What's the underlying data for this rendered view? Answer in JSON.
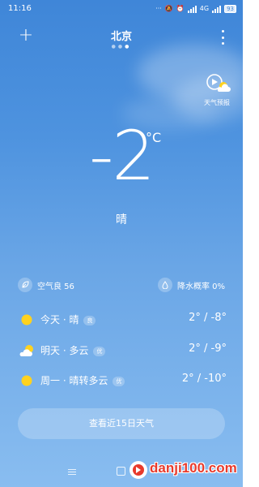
{
  "status_bar": {
    "time": "11:16",
    "network": "4G",
    "battery": "93"
  },
  "header": {
    "city": "北京",
    "page_dots": 3,
    "active_dot": 2
  },
  "forecast_video": {
    "label": "天气预报"
  },
  "current": {
    "temperature": "-2",
    "unit": "°C",
    "condition": "晴"
  },
  "info": {
    "air_quality": "空气良 56",
    "precipitation": "降水概率 0%"
  },
  "days": [
    {
      "label": "今天 · 晴",
      "badge": "良",
      "temps": "2° / -8°",
      "icon": "sun-icon"
    },
    {
      "label": "明天 · 多云",
      "badge": "优",
      "temps": "2° / -9°",
      "icon": "partly-cloudy-icon"
    },
    {
      "label": "周一 · 晴转多云",
      "badge": "优",
      "temps": "2° / -10°",
      "icon": "sun-icon"
    }
  ],
  "button_15day": "查看近15日天气",
  "watermark": "danji100.com",
  "colors": {
    "sun": "#ffd21f",
    "sky_top": "#3f86d8",
    "sky_bottom": "#89bdf0",
    "watermark": "#e83a2c"
  }
}
